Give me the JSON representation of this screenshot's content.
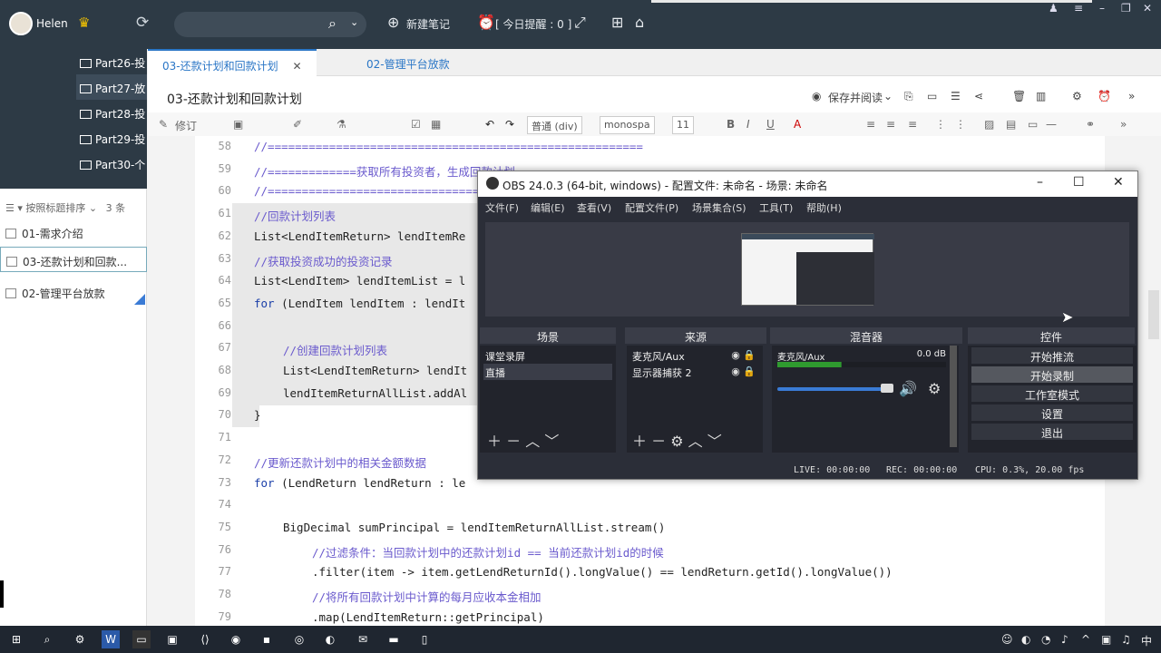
{
  "topbar": {
    "username": "Helen",
    "new_note": "新建笔记",
    "reminder": "[ 今日提醒 : 0 ]",
    "icons": [
      "avatar-icon",
      "crown-icon",
      "sync-icon",
      "search-icon",
      "plus-icon",
      "alarm-icon",
      "export-icon",
      "grid-icon",
      "home-icon"
    ]
  },
  "sidebar": {
    "folders": [
      "Part26-投",
      "Part27-放",
      "Part28-投",
      "Part29-投",
      "Part30-个"
    ],
    "sort_label": "按照标题排序",
    "count": "3 条",
    "notes": [
      "01-需求介绍",
      "03-还款计划和回款...",
      "02-管理平台放款"
    ]
  },
  "tabs": [
    {
      "label": "03-还款计划和回款计划",
      "close": "✕"
    },
    {
      "label": "02-管理平台放款"
    }
  ],
  "doc": {
    "title": "03-还款计划和回款计划",
    "save_read": "保存并阅读"
  },
  "format_bar": {
    "revise": "修订",
    "style": "普通 (div)",
    "font": "monospa",
    "size": "11"
  },
  "code": {
    "lines": [
      {
        "n": "58",
        "t": "//=======================================================",
        "c": "cmt",
        "i": 0
      },
      {
        "n": "59",
        "t": "//=============获取所有投资者，生成回款计划==================",
        "c": "cmt",
        "i": 0
      },
      {
        "n": "60",
        "t": "//=================================================",
        "c": "cmt",
        "i": 0
      },
      {
        "n": "61",
        "t": "//回款计划列表",
        "c": "cmt",
        "i": 0
      },
      {
        "n": "62",
        "t": "List<LendItemReturn> lendItemRe",
        "c": "",
        "i": 0
      },
      {
        "n": "63",
        "t": "//获取投资成功的投资记录",
        "c": "cmt",
        "i": 0
      },
      {
        "n": "64",
        "t": "List<LendItem> lendItemList = l",
        "c": "",
        "i": 0
      },
      {
        "n": "65",
        "t": "for (LendItem lendItem : lendIt",
        "c": "kwl",
        "i": 0
      },
      {
        "n": "66",
        "t": "",
        "c": "",
        "i": 0
      },
      {
        "n": "67",
        "t": "//创建回款计划列表",
        "c": "cmt",
        "i": 1
      },
      {
        "n": "68",
        "t": "List<LendItemReturn> lendIt",
        "c": "",
        "i": 1
      },
      {
        "n": "69",
        "t": "lendItemReturnAllList.addAl",
        "c": "",
        "i": 1
      },
      {
        "n": "70",
        "t": "}",
        "c": "",
        "i": 0
      },
      {
        "n": "71",
        "t": "",
        "c": "",
        "i": 0
      },
      {
        "n": "72",
        "t": "//更新还款计划中的相关金额数据",
        "c": "cmt",
        "i": 0
      },
      {
        "n": "73",
        "t": "for (LendReturn lendReturn : le",
        "c": "kwl",
        "i": 0
      },
      {
        "n": "74",
        "t": "",
        "c": "",
        "i": 0
      },
      {
        "n": "75",
        "t": "BigDecimal sumPrincipal = lendItemReturnAllList.stream()",
        "c": "",
        "i": 1
      },
      {
        "n": "76",
        "t": "//过滤条件：当回款计划中的还款计划id == 当前还款计划id的时候",
        "c": "cmt",
        "i": 2
      },
      {
        "n": "77",
        "t": ".filter(item -> item.getLendReturnId().longValue() == lendReturn.getId().longValue())",
        "c": "",
        "i": 2
      },
      {
        "n": "78",
        "t": "//将所有回款计划中计算的每月应收本金相加",
        "c": "cmt",
        "i": 2
      },
      {
        "n": "79",
        "t": ".map(LendItemReturn::getPrincipal)",
        "c": "",
        "i": 2
      }
    ]
  },
  "obs": {
    "title": "OBS 24.0.3 (64-bit, windows) - 配置文件: 未命名 - 场景: 未命名",
    "menu": [
      "文件(F)",
      "编辑(E)",
      "查看(V)",
      "配置文件(P)",
      "场景集合(S)",
      "工具(T)",
      "帮助(H)"
    ],
    "docks": {
      "scenes": "场景",
      "sources": "来源",
      "mixer": "混音器",
      "controls": "控件"
    },
    "scenes": [
      "课堂录屏",
      "直播"
    ],
    "sources": [
      "麦克风/Aux",
      "显示器捕获 2"
    ],
    "mixer_name": "麦克风/Aux",
    "mixer_db": "0.0 dB",
    "mixer_level": 0.38,
    "controls": [
      "开始推流",
      "开始录制",
      "工作室模式",
      "设置",
      "退出"
    ],
    "live": "LIVE: 00:00:00",
    "rec": "REC: 00:00:00",
    "cpu": "CPU: 0.3%, 20.00 fps"
  },
  "colors": {
    "accent": "#2a76c6",
    "topbar": "#2d3a45",
    "obs_bg": "#2b2e38"
  }
}
